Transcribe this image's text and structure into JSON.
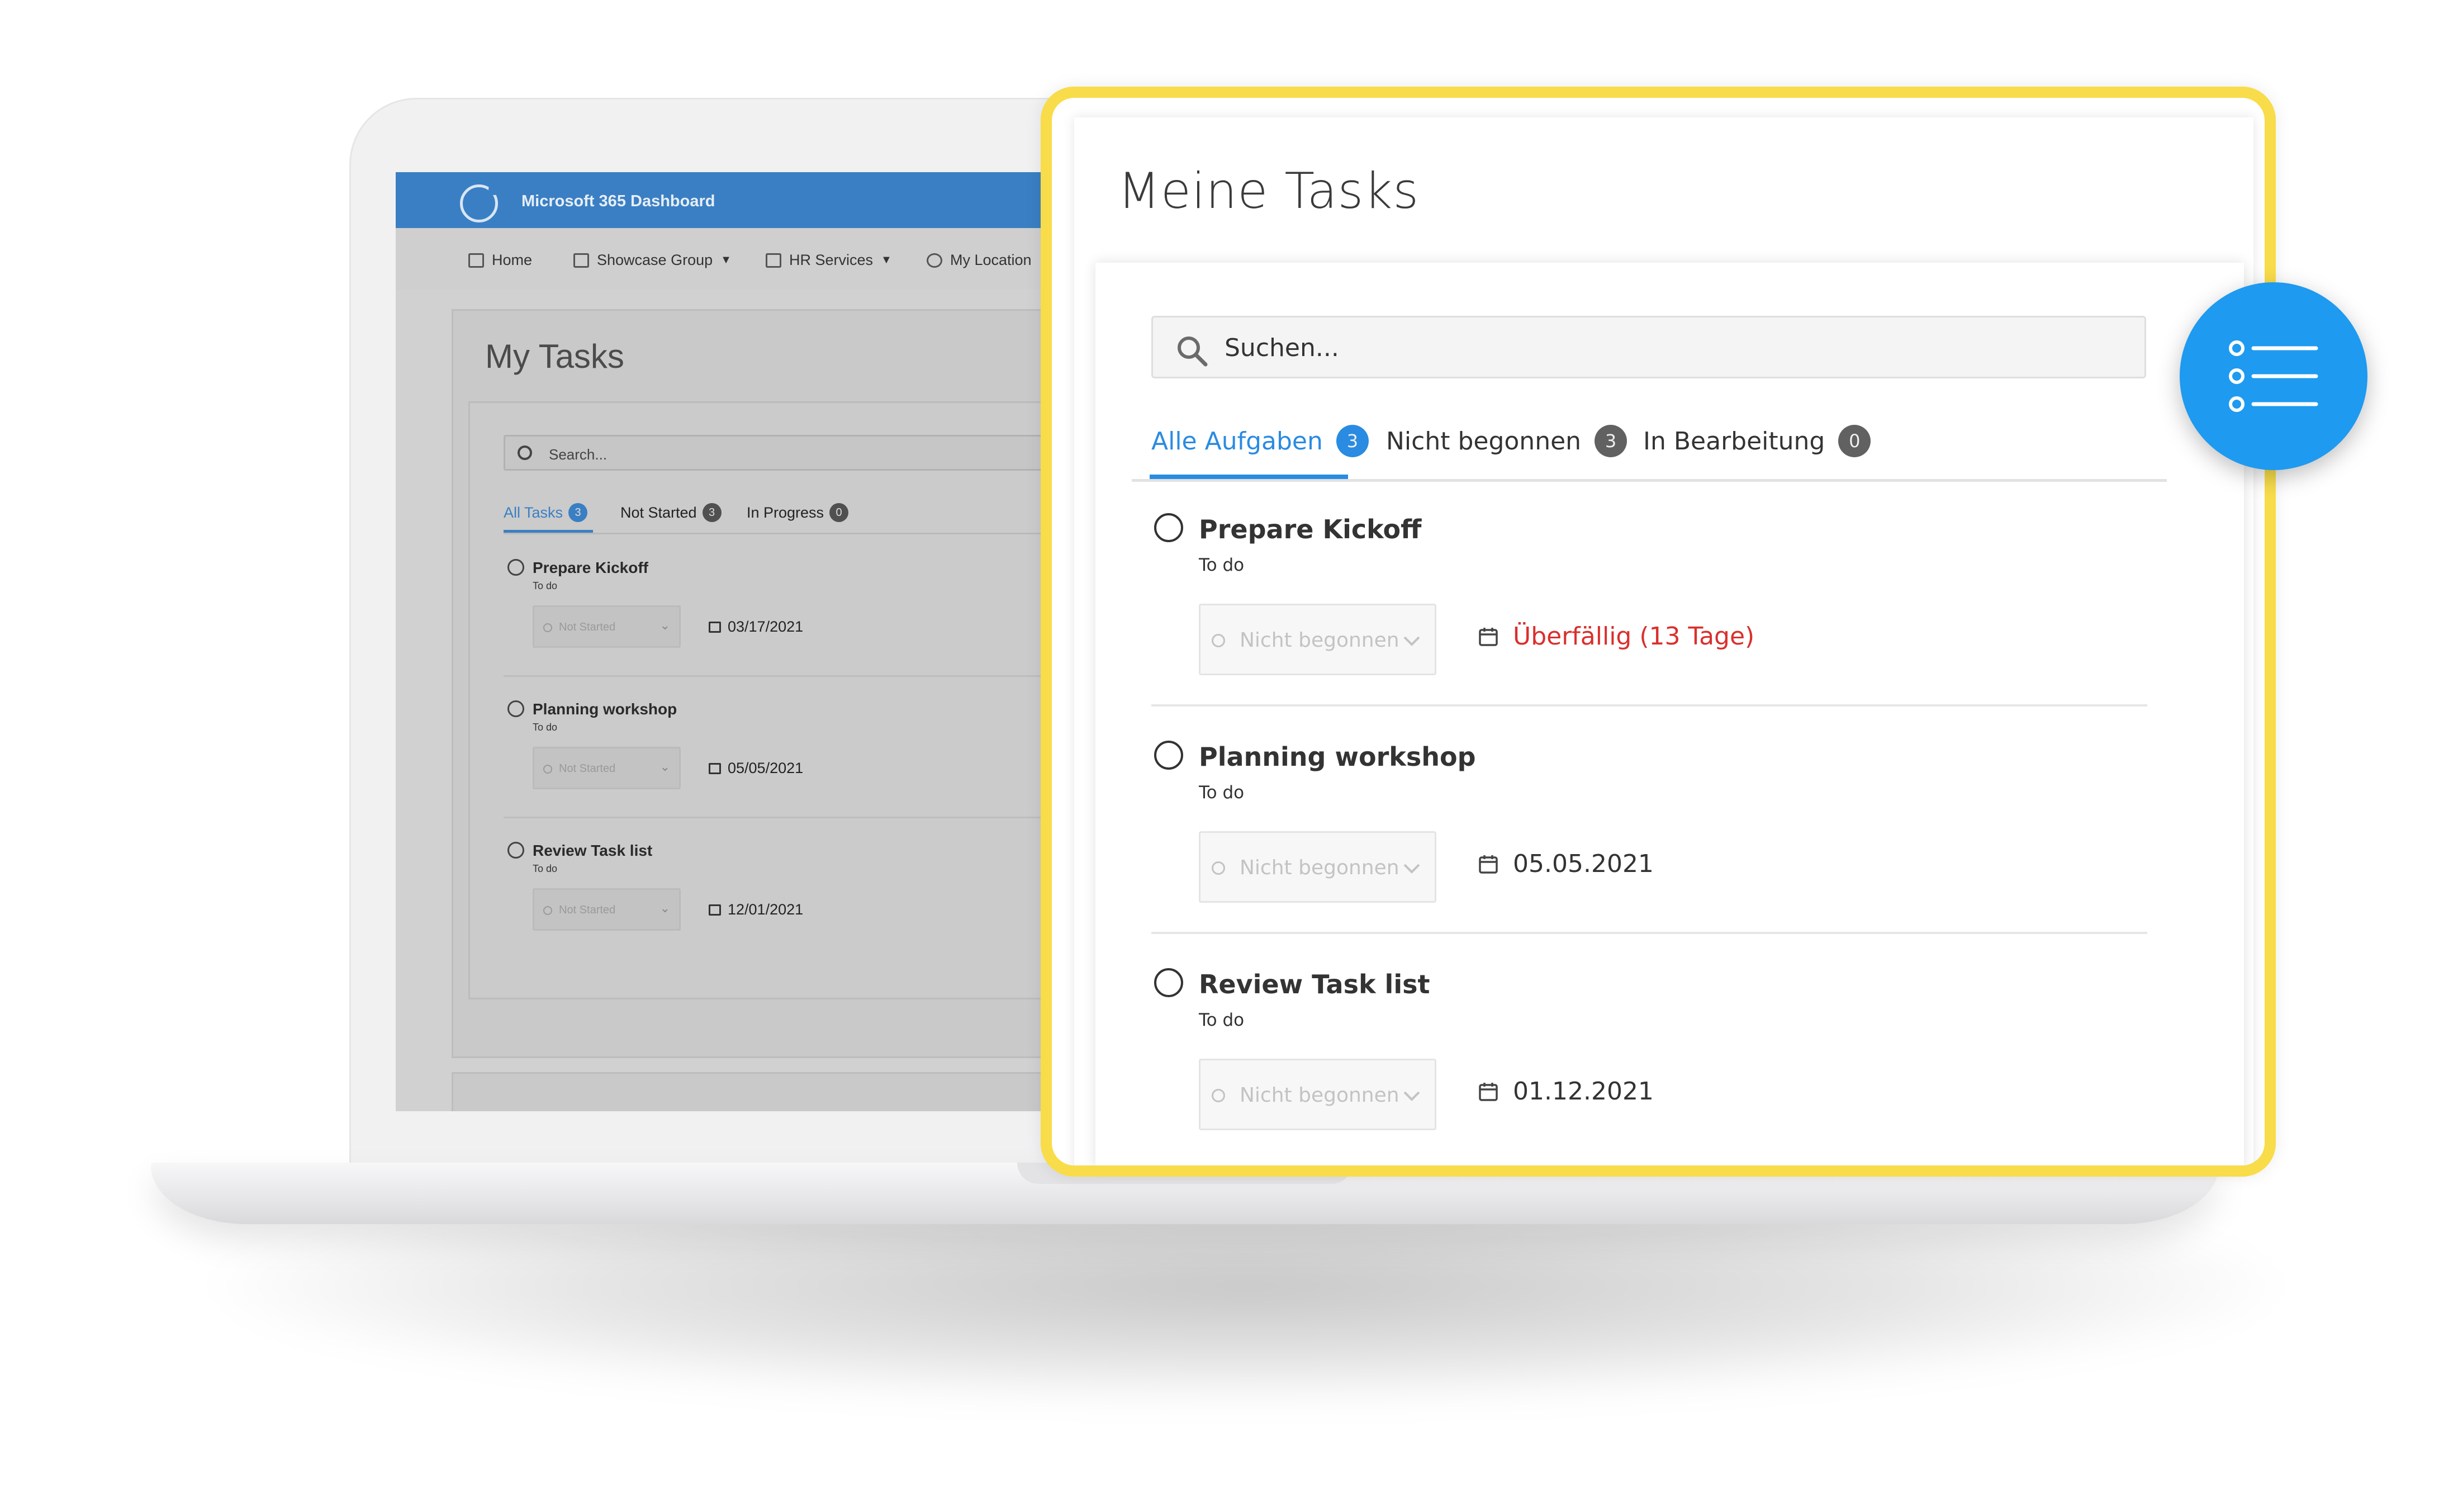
{
  "laptop_screen": {
    "app_title": "Microsoft 365 Dashboard",
    "nav": [
      {
        "label": "Home",
        "icon": "home-icon"
      },
      {
        "label": "Showcase Group",
        "icon": "building-icon",
        "caret": "▼"
      },
      {
        "label": "HR Services",
        "icon": "folder-icon",
        "caret": "▼"
      },
      {
        "label": "My Location",
        "icon": "globe-icon"
      }
    ],
    "page_title": "My Tasks",
    "search_placeholder": "Search...",
    "tabs": [
      {
        "label": "All Tasks",
        "count": "3",
        "active": true
      },
      {
        "label": "Not Started",
        "count": "3"
      },
      {
        "label": "In Progress",
        "count": "0"
      }
    ],
    "tasks": [
      {
        "title": "Prepare Kickoff",
        "bucket": "To do",
        "status": "Not Started",
        "due": "03/17/2021"
      },
      {
        "title": "Planning workshop",
        "bucket": "To do",
        "status": "Not Started",
        "due": "05/05/2021"
      },
      {
        "title": "Review Task list",
        "bucket": "To do",
        "status": "Not Started",
        "due": "12/01/2021"
      }
    ]
  },
  "panel": {
    "title": "Meine Tasks",
    "search_placeholder": "Suchen...",
    "tabs": [
      {
        "label": "Alle Aufgaben",
        "count": "3",
        "active": true
      },
      {
        "label": "Nicht begonnen",
        "count": "3"
      },
      {
        "label": "In Bearbeitung",
        "count": "0"
      }
    ],
    "tasks": [
      {
        "title": "Prepare Kickoff",
        "bucket": "To do",
        "status": "Nicht begonnen",
        "due": "Überfällig (13 Tage)",
        "overdue": true
      },
      {
        "title": "Planning workshop",
        "bucket": "To do",
        "status": "Nicht begonnen",
        "due": "05.05.2021"
      },
      {
        "title": "Review Task list",
        "bucket": "To do",
        "status": "Nicht begonnen",
        "due": "01.12.2021"
      }
    ]
  },
  "floating_icon": "task-list-icon",
  "colors": {
    "accent_blue": "#2a8be2",
    "highlight_yellow": "#f8dc4a",
    "overdue_red": "#d9302d",
    "fab_blue": "#1e9af0",
    "dashboard_topbar": "#3a7fc3"
  }
}
